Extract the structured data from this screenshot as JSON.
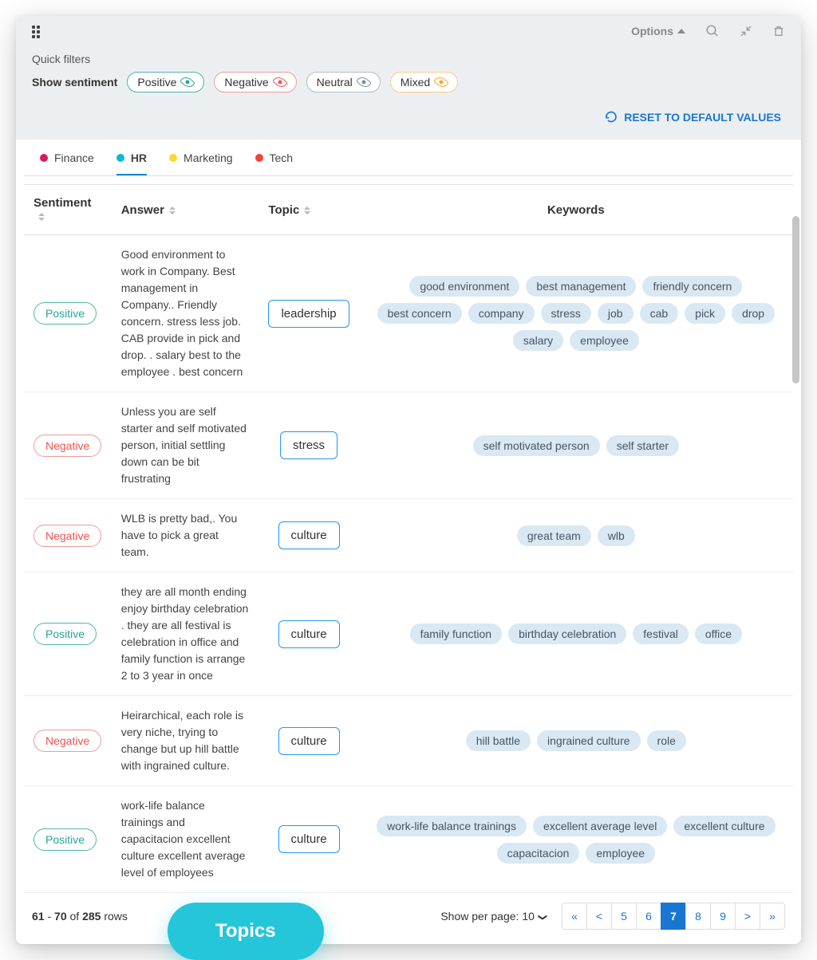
{
  "header": {
    "options_label": "Options"
  },
  "filters": {
    "quick_label": "Quick filters",
    "show_label": "Show sentiment",
    "positive": "Positive",
    "negative": "Negative",
    "neutral": "Neutral",
    "mixed": "Mixed",
    "reset_label": "RESET TO DEFAULT VALUES"
  },
  "tabs": [
    {
      "label": "Finance",
      "color": "#d81b60",
      "active": false
    },
    {
      "label": "HR",
      "color": "#00bcd4",
      "active": true
    },
    {
      "label": "Marketing",
      "color": "#fdd835",
      "active": false
    },
    {
      "label": "Tech",
      "color": "#f44336",
      "active": false
    }
  ],
  "columns": {
    "sentiment": "Sentiment",
    "answer": "Answer",
    "topic": "Topic",
    "keywords": "Keywords"
  },
  "rows": [
    {
      "sentiment": "Positive",
      "sentiment_class": "positive",
      "answer": "Good environment to work in Company. Best management in Company.. Friendly concern. stress less job. CAB provide in pick and drop. . salary best to the employee . best concern",
      "topic": "leadership",
      "keywords": [
        "good environment",
        "best management",
        "friendly concern",
        "best concern",
        "company",
        "stress",
        "job",
        "cab",
        "pick",
        "drop",
        "salary",
        "employee"
      ]
    },
    {
      "sentiment": "Negative",
      "sentiment_class": "negative",
      "answer": "Unless you are self starter and self motivated person, initial settling down can be bit frustrating",
      "topic": "stress",
      "keywords": [
        "self motivated person",
        "self starter"
      ]
    },
    {
      "sentiment": "Negative",
      "sentiment_class": "negative",
      "answer": "WLB is pretty bad,. You have to pick a great team.",
      "topic": "culture",
      "keywords": [
        "great team",
        "wlb"
      ]
    },
    {
      "sentiment": "Positive",
      "sentiment_class": "positive",
      "answer": "they are all month ending enjoy birthday celebration . they are all festival is celebration in office and family function is arrange 2 to 3 year in once",
      "topic": "culture",
      "keywords": [
        "family function",
        "birthday celebration",
        "festival",
        "office"
      ]
    },
    {
      "sentiment": "Negative",
      "sentiment_class": "negative",
      "answer": "Heirarchical, each role is very niche, trying to change but up hill battle with ingrained culture.",
      "topic": "culture",
      "keywords": [
        "hill battle",
        "ingrained culture",
        "role"
      ]
    },
    {
      "sentiment": "Positive",
      "sentiment_class": "positive",
      "answer": "work-life balance trainings and capacitacion excellent culture excellent average level of employees",
      "topic": "culture",
      "keywords": [
        "work-life balance trainings",
        "excellent average level",
        "excellent culture",
        "capacitacion",
        "employee"
      ]
    }
  ],
  "footer": {
    "range_from": "61",
    "range_to": "70",
    "of_word": "of",
    "total": "285",
    "rows_word": "rows",
    "per_page_label": "Show per page:",
    "per_page_value": "10",
    "pages": [
      "«",
      "<",
      "5",
      "6",
      "7",
      "8",
      "9",
      ">",
      "»"
    ],
    "active_page": "7"
  },
  "badge": "Topics"
}
